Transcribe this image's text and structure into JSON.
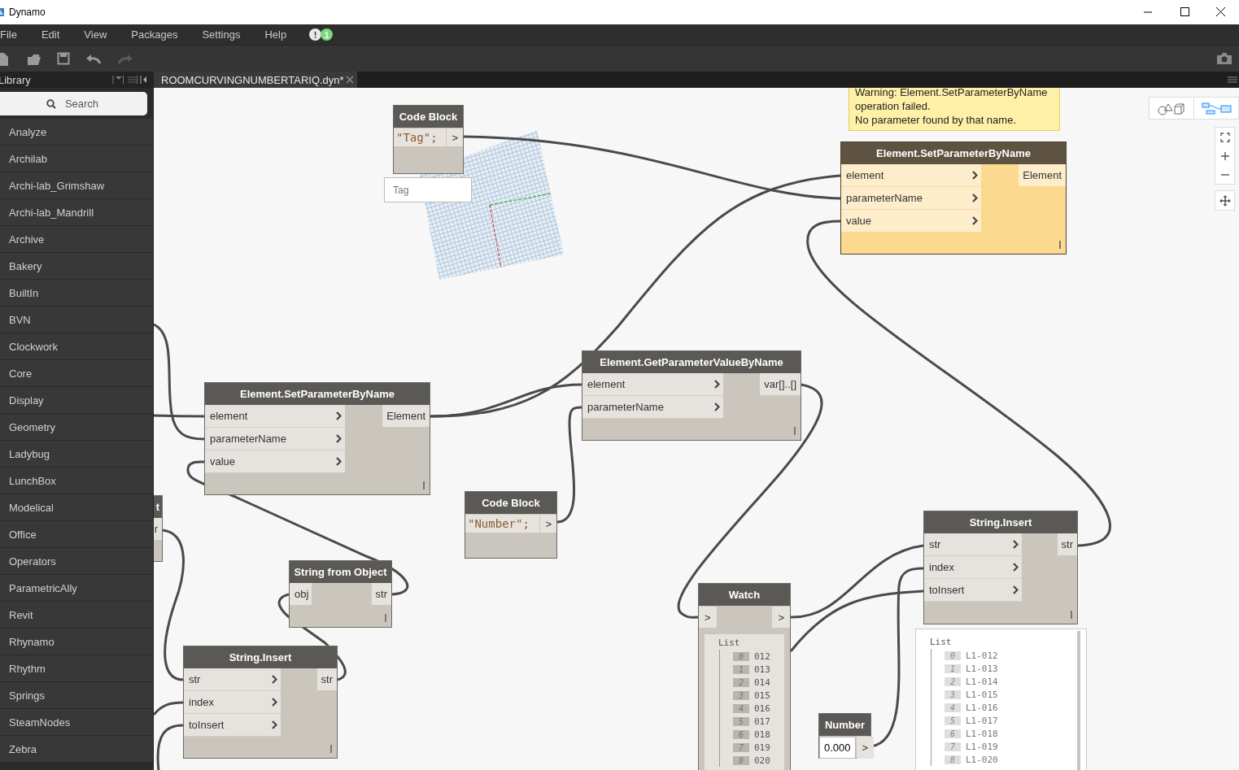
{
  "window": {
    "title": "Dynamo"
  },
  "menu": [
    {
      "label": "File"
    },
    {
      "label": "Edit"
    },
    {
      "label": "View"
    },
    {
      "label": "Packages"
    },
    {
      "label": "Settings"
    },
    {
      "label": "Help"
    }
  ],
  "notifications": [
    {
      "kind": "warning",
      "label": "!"
    },
    {
      "kind": "count",
      "label": "1"
    }
  ],
  "library": {
    "title": "Library",
    "search": {
      "placeholder": "Search"
    },
    "items": [
      "Analyze",
      "Archilab",
      "Archi-lab_Grimshaw",
      "Archi-lab_Mandrill",
      "Archive",
      "Bakery",
      "BuiltIn",
      "BVN",
      "Clockwork",
      "Core",
      "Display",
      "Geometry",
      "Ladybug",
      "LunchBox",
      "Modelical",
      "Office",
      "Operators",
      "ParametricAlly",
      "Revit",
      "Rhynamo",
      "Rhythm",
      "Springs",
      "SteamNodes",
      "Zebra"
    ]
  },
  "tabs": [
    {
      "label": "ROOMCURVINGNUMBERTARIQ.dyn*",
      "selected": true
    }
  ],
  "view_modes": [
    {
      "kind": "geometry",
      "selected": false
    },
    {
      "kind": "graph",
      "selected": true
    }
  ],
  "nodes": [
    {
      "kind": "code_block",
      "title": "Code Block",
      "code": "\"Tag\";",
      "output": ">",
      "preview": {
        "kind": "value",
        "text": "Tag"
      }
    },
    {
      "kind": "function",
      "title": "Element.SetParameterByName",
      "warning": true,
      "message": [
        "Warning: Element.SetParameterByName",
        "operation failed.",
        "No parameter found by that name."
      ],
      "inputs": [
        "element",
        "parameterName",
        "value"
      ],
      "outputs": [
        "Element"
      ]
    },
    {
      "kind": "function",
      "title": "Element.GetParameterValueByName",
      "warning": false,
      "inputs": [
        "element",
        "parameterName"
      ],
      "outputs": [
        "var[]..[]"
      ]
    },
    {
      "kind": "function",
      "title": "Element.SetParameterByName",
      "warning": false,
      "inputs": [
        "element",
        "parameterName",
        "value"
      ],
      "outputs": [
        "Element"
      ]
    },
    {
      "kind": "partial",
      "title": "t",
      "outputs": [
        "r"
      ]
    },
    {
      "kind": "code_block",
      "title": "Code Block",
      "code": "\"Number\";",
      "output": ">"
    },
    {
      "kind": "function",
      "title": "String.Insert",
      "warning": false,
      "inputs": [
        "str",
        "index",
        "toInsert"
      ],
      "outputs": [
        "str"
      ],
      "preview": {
        "kind": "list",
        "title": "List",
        "items": [
          {
            "index": "0",
            "value": "L1-012"
          },
          {
            "index": "1",
            "value": "L1-013"
          },
          {
            "index": "2",
            "value": "L1-014"
          },
          {
            "index": "3",
            "value": "L1-015"
          },
          {
            "index": "4",
            "value": "L1-016"
          },
          {
            "index": "5",
            "value": "L1-017"
          },
          {
            "index": "6",
            "value": "L1-018"
          },
          {
            "index": "7",
            "value": "L1-019"
          },
          {
            "index": "8",
            "value": "L1-020"
          }
        ]
      }
    },
    {
      "kind": "function",
      "title": "String from Object",
      "warning": false,
      "inputs": [
        "obj"
      ],
      "outputs": [
        "str"
      ]
    },
    {
      "kind": "watch",
      "title": "Watch",
      "input": ">",
      "output": ">",
      "list": {
        "title": "List",
        "items": [
          {
            "index": "0",
            "value": "012"
          },
          {
            "index": "1",
            "value": "013"
          },
          {
            "index": "2",
            "value": "014"
          },
          {
            "index": "3",
            "value": "015"
          },
          {
            "index": "4",
            "value": "016"
          },
          {
            "index": "5",
            "value": "017"
          },
          {
            "index": "6",
            "value": "018"
          },
          {
            "index": "7",
            "value": "019"
          },
          {
            "index": "8",
            "value": "020"
          }
        ]
      }
    },
    {
      "kind": "function",
      "title": "String.Insert",
      "warning": false,
      "inputs": [
        "str",
        "index",
        "toInsert"
      ],
      "outputs": [
        "str"
      ]
    },
    {
      "kind": "number",
      "title": "Number",
      "value": "0.000",
      "output": ">"
    }
  ]
}
